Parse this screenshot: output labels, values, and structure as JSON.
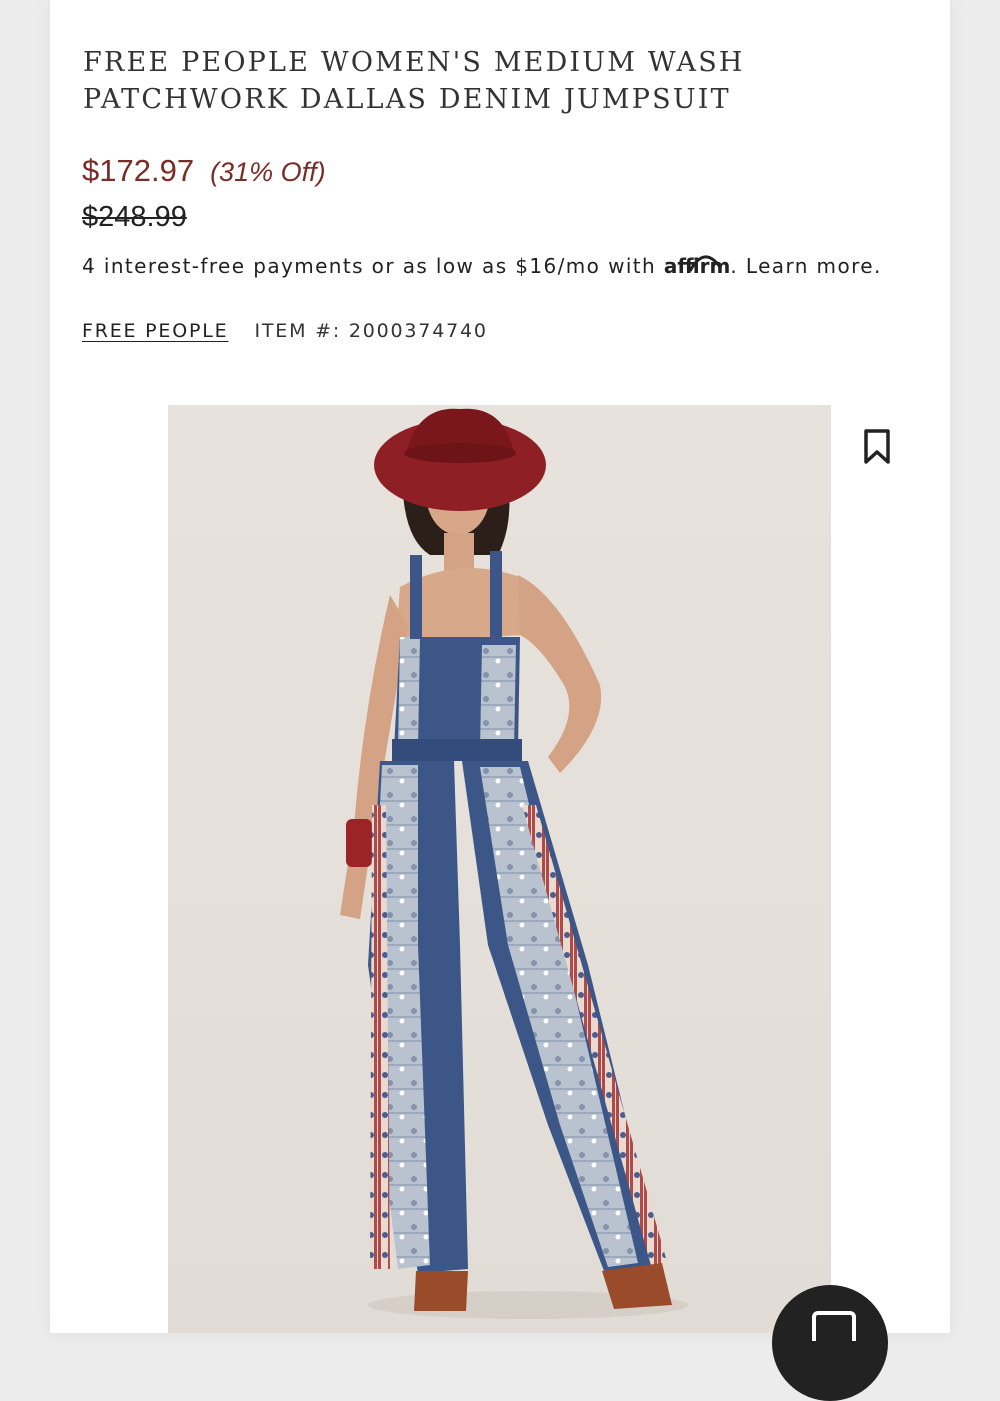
{
  "product": {
    "title_line1": "FREE PEOPLE WOMEN'S MEDIUM WASH",
    "title_line2": "PATCHWORK DALLAS DENIM JUMPSUIT",
    "sale_price": "$172.97",
    "discount": "(31% Off)",
    "original_price": "$248.99",
    "brand": "FREE PEOPLE",
    "item_number": "ITEM #: 2000374740"
  },
  "financing": {
    "text": "4 interest-free payments or as low as $16/mo with",
    "provider": "affirm",
    "learn_more": ". Learn more."
  },
  "colors": {
    "price": "#7a2c27",
    "hat": "#8e1f24",
    "denim_dark": "#3c5687",
    "denim_light": "#b7c0cc",
    "background": "#e8e2dc"
  },
  "icons": {
    "bookmark": "bookmark-icon",
    "chat": "chat-icon"
  }
}
